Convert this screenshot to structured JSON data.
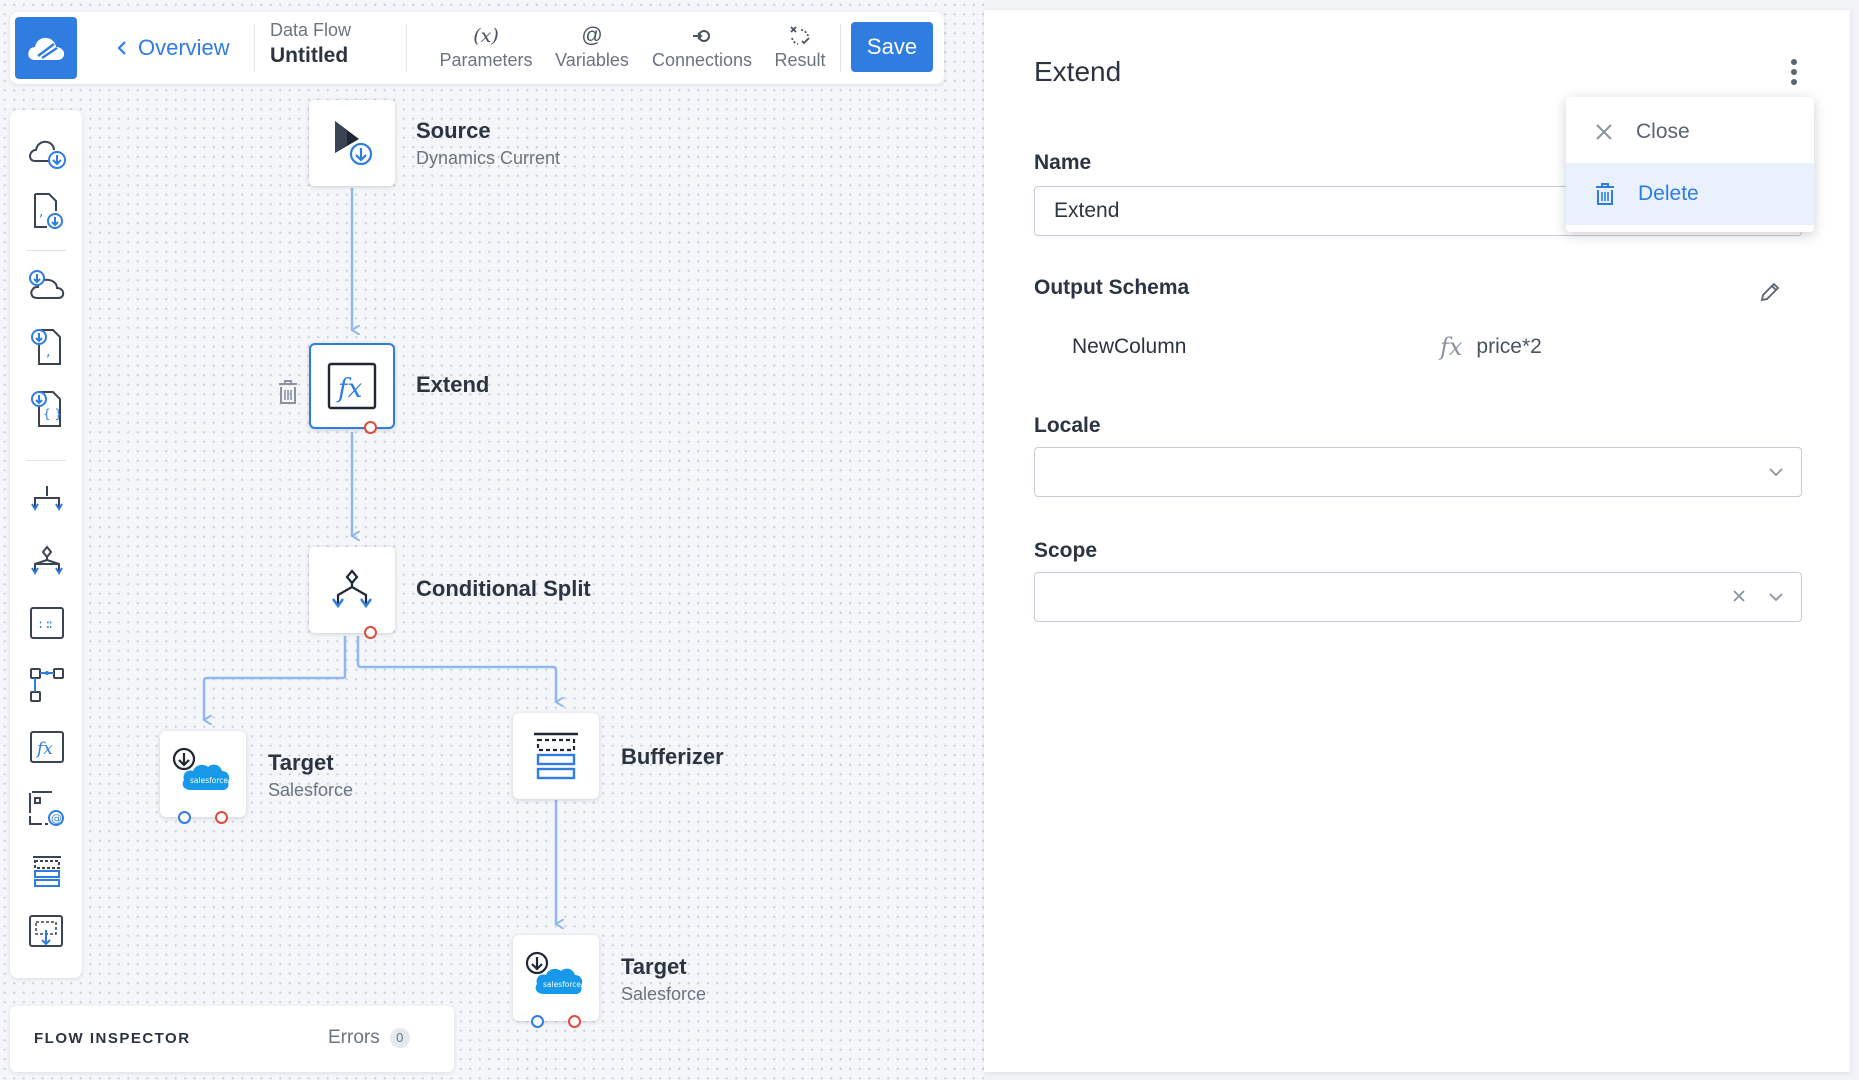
{
  "toolbar": {
    "back_label": "Overview",
    "flow_kind": "Data Flow",
    "flow_name": "Untitled",
    "items": [
      {
        "label": "Parameters",
        "glyph": "(x)"
      },
      {
        "label": "Variables",
        "glyph": "@"
      },
      {
        "label": "Connections",
        "glyph": "connections-icon"
      },
      {
        "label": "Result",
        "glyph": "result-icon"
      }
    ],
    "save_label": "Save"
  },
  "palette": {
    "items": [
      "cloud-download-icon",
      "file-json-download-icon",
      "cloud-source-icon",
      "file-json-source-icon",
      "file-xml-source-icon",
      "split-icon",
      "conditional-split-icon",
      "lookup-icon",
      "join-icon",
      "extend-fx-icon",
      "variable-icon",
      "bufferizer-icon",
      "unbufferizer-icon"
    ]
  },
  "inspector": {
    "title": "FLOW INSPECTOR",
    "errors_label": "Errors",
    "errors_count": "0"
  },
  "nodes": {
    "source": {
      "label": "Source",
      "sub": "Dynamics Current"
    },
    "extend": {
      "label": "Extend"
    },
    "split": {
      "label": "Conditional Split"
    },
    "target1": {
      "label": "Target",
      "sub": "Salesforce"
    },
    "bufferizer": {
      "label": "Bufferizer"
    },
    "target2": {
      "label": "Target",
      "sub": "Salesforce"
    },
    "salesforce_logo_text": "salesforce"
  },
  "panel": {
    "title": "Extend",
    "name_label": "Name",
    "name_value": "Extend",
    "output_schema_label": "Output Schema",
    "schema": [
      {
        "column": "NewColumn",
        "expression": "price*2"
      }
    ],
    "locale_label": "Locale",
    "locale_value": "",
    "scope_label": "Scope",
    "scope_value": ""
  },
  "menu": {
    "close_label": "Close",
    "delete_label": "Delete"
  },
  "colors": {
    "accent": "#2f7de1",
    "port_out": "#e04b3c",
    "link": "#8fb8ee"
  }
}
